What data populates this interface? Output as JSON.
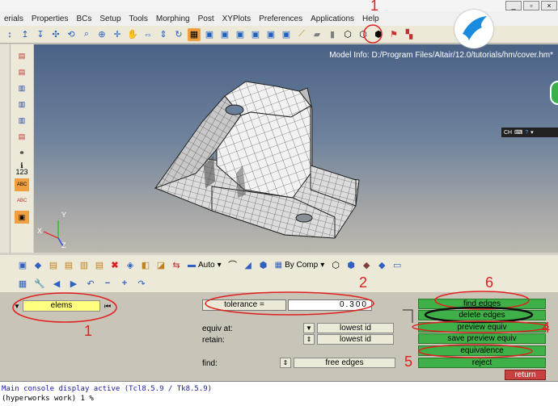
{
  "menu": {
    "items": [
      "erials",
      "Properties",
      "BCs",
      "Setup",
      "Tools",
      "Morphing",
      "Post",
      "XYPlots",
      "Preferences",
      "Applications",
      "Help"
    ]
  },
  "viewport": {
    "model_info": "Model Info: D:/Program Files/Altair/12.0/tutorials/hm/cover.hm*",
    "axis_x": "X",
    "axis_y": "Y",
    "axis_z": "Z",
    "mini_ctrl": "CH"
  },
  "toolbar2": {
    "auto_label": "Auto",
    "by_comp_label": "By Comp"
  },
  "left_toolbar": {
    "num_label": "123",
    "abc_label_1": "ABC",
    "abc_label_2": "ABC"
  },
  "panel": {
    "entity": "elems",
    "tolerance_label": "tolerance =",
    "tolerance_value": "0.300",
    "equiv_at_label": "equiv at:",
    "equiv_at_value": "lowest id",
    "retain_label": "retain:",
    "retain_value": "lowest id",
    "find_label": "find:",
    "find_value": "free edges",
    "buttons": {
      "find_edges": "find edges",
      "delete_edges": "delete edges",
      "preview_equiv": "preview equiv",
      "save_preview_equiv": "save preview equiv",
      "equivalence": "equivalence",
      "reject": "reject",
      "return": "return"
    }
  },
  "console": {
    "line1": "Main console display active (Tcl8.5.9 / Tk8.5.9)",
    "line2": "(hyperworks  work) 1 %"
  },
  "annotations": {
    "num1_top": "1",
    "num2": "2",
    "num6": "6",
    "num4": "4",
    "num5": "5",
    "num1_bottom": "1"
  },
  "colors": {
    "green_button": "#3fb048",
    "return_button": "#c84040",
    "annotation_red": "#e02020",
    "highlight_yellow": "#ffff80"
  }
}
